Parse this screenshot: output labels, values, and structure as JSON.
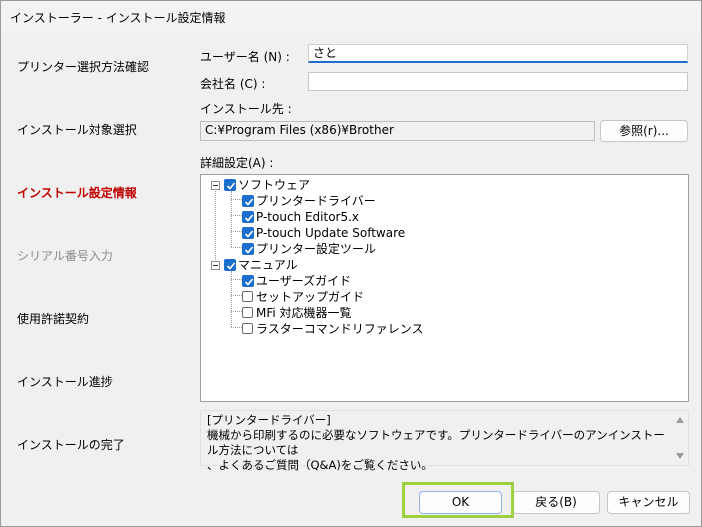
{
  "window": {
    "title": "インストーラー - インストール設定情報"
  },
  "sidebar": {
    "steps": [
      {
        "label": "プリンター選択方法確認"
      },
      {
        "label": "インストール対象選択"
      },
      {
        "label": "インストール設定情報"
      },
      {
        "label": "シリアル番号入力"
      },
      {
        "label": "使用許諾契約"
      },
      {
        "label": "インストール進捗"
      },
      {
        "label": "インストールの完了"
      }
    ]
  },
  "form": {
    "user_label": "ユーザー名 (N) :",
    "user_value": "さと",
    "company_label": "会社名 (C) :",
    "company_value": "",
    "dest_label": "インストール先 :",
    "dest_value": "C:¥Program Files (x86)¥Brother",
    "browse_label": "参照(r)...",
    "advanced_label": "詳細設定(A) :"
  },
  "tree": {
    "software": "ソフトウェア",
    "driver": "プリンタードライバー",
    "editor": "P-touch Editor5.x",
    "update": "P-touch Update Software",
    "settings_tool": "プリンター設定ツール",
    "manual": "マニュアル",
    "user_guide": "ユーザーズガイド",
    "setup_guide": "セットアップガイド",
    "mfi": "MFi 対応機器一覧",
    "raster": "ラスターコマンドリファレンス"
  },
  "description": {
    "title": "[プリンタードライバー]",
    "line1": "機械から印刷するのに必要なソフトウェアです。プリンタードライバーのアンインストール方法については",
    "line2": "、よくあるご質問（Q&A)をご覧ください。"
  },
  "buttons": {
    "ok": "OK",
    "back": "戻る(B)",
    "cancel": "キャンセル"
  },
  "colors": {
    "accent": "#1a6ecd",
    "active_step": "#c00000",
    "highlight": "#9ed142"
  }
}
